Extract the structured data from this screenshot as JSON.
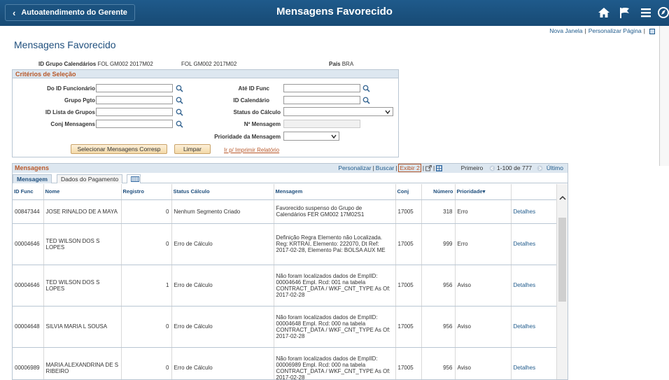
{
  "header": {
    "back_label": "Autoatendimento do Gerente",
    "title": "Mensagens Favorecido",
    "icons": [
      "home-icon",
      "flag-icon",
      "menu-icon",
      "navbar-icon"
    ]
  },
  "page_links": {
    "new_window": "Nova Janela",
    "personalize": "Personalizar Página"
  },
  "page_title": "Mensagens Favorecido",
  "info": {
    "group_label": "ID Grupo Calendários",
    "group_value1": "FOL GM002 2017M02",
    "group_value2": "FOL GM002 2017M02",
    "country_label": "País",
    "country_value": "BRA"
  },
  "criteria": {
    "title": "Critérios de Seleção",
    "from_emp_label": "Do ID Funcionário",
    "to_emp_label": "Até ID Func",
    "paygroup_label": "Grupo Pgto",
    "calendar_label": "ID Calendário",
    "grouplist_label": "ID Lista de Grupos",
    "calc_status_label": "Status do Cálculo",
    "msgset_label": "Conj Mensagens",
    "msgnum_label": "Nº Mensagem",
    "priority_label": "Prioridade da Mensagem",
    "select_button": "Selecionar Mensagens Corresp",
    "clear_button": "Limpar",
    "print_link": "Ir p/ Imprimir Relatório"
  },
  "grid": {
    "title": "Mensagens",
    "personalize": "Personalizar",
    "find": "Buscar",
    "view": "Exibir 2",
    "first": "Primeiro",
    "range": "1-100 de 777",
    "last": "Último",
    "tabs": [
      "Mensagem",
      "Dados do Pagamento"
    ],
    "columns": [
      "ID Func",
      "Nome",
      "Registro",
      "Status Cálculo",
      "Mensagem",
      "Conj",
      "Número",
      "Prioridade"
    ],
    "rows": [
      {
        "id": "00847344",
        "name": "JOSE RINALDO DE A MAYA",
        "reg": "0",
        "status": "Nenhum Segmento Criado",
        "msg": "Favorecido suspenso do Grupo de Calendários FER GM002 17M02S1",
        "conj": "17005",
        "num": "318",
        "prio": "Erro",
        "link": "Detalhes"
      },
      {
        "id": "00004646",
        "name": "TED WILSON DOS S LOPES",
        "reg": "0",
        "status": "Erro de Cálculo",
        "msg": "Definição Regra Elemento não Localizada. Reg: KRTRAI, Elemento: 222070, Dt Ref: 2017-02-28, Elemento Pai: BOLSA AUX ME",
        "conj": "17005",
        "num": "999",
        "prio": "Erro",
        "link": "Detalhes"
      },
      {
        "id": "00004646",
        "name": "TED WILSON DOS S LOPES",
        "reg": "1",
        "status": "Erro de Cálculo",
        "msg": "Não foram localizados dados de EmplID: 00004646 Empl. Rcd: 001 na tabela CONTRACT_DATA / WKF_CNT_TYPE As Of: 2017-02-28",
        "conj": "17005",
        "num": "956",
        "prio": "Aviso",
        "link": "Detalhes"
      },
      {
        "id": "00004648",
        "name": "SILVIA MARIA L SOUSA",
        "reg": "0",
        "status": "Erro de Cálculo",
        "msg": "Não foram localizados dados de EmplID: 00004648 Empl. Rcd: 000 na tabela CONTRACT_DATA / WKF_CNT_TYPE As Of: 2017-02-28",
        "conj": "17005",
        "num": "956",
        "prio": "Aviso",
        "link": "Detalhes"
      },
      {
        "id": "00006989",
        "name": "MARIA ALEXANDRINA DE S RIBEIRO",
        "reg": "0",
        "status": "Erro de Cálculo",
        "msg": "Não foram localizados dados de EmplID: 00006989 Empl. Rcd: 000 na tabela CONTRACT_DATA / WKF_CNT_TYPE As Of: 2017-02-28",
        "conj": "17005",
        "num": "956",
        "prio": "Aviso",
        "link": "Detalhes"
      }
    ]
  }
}
